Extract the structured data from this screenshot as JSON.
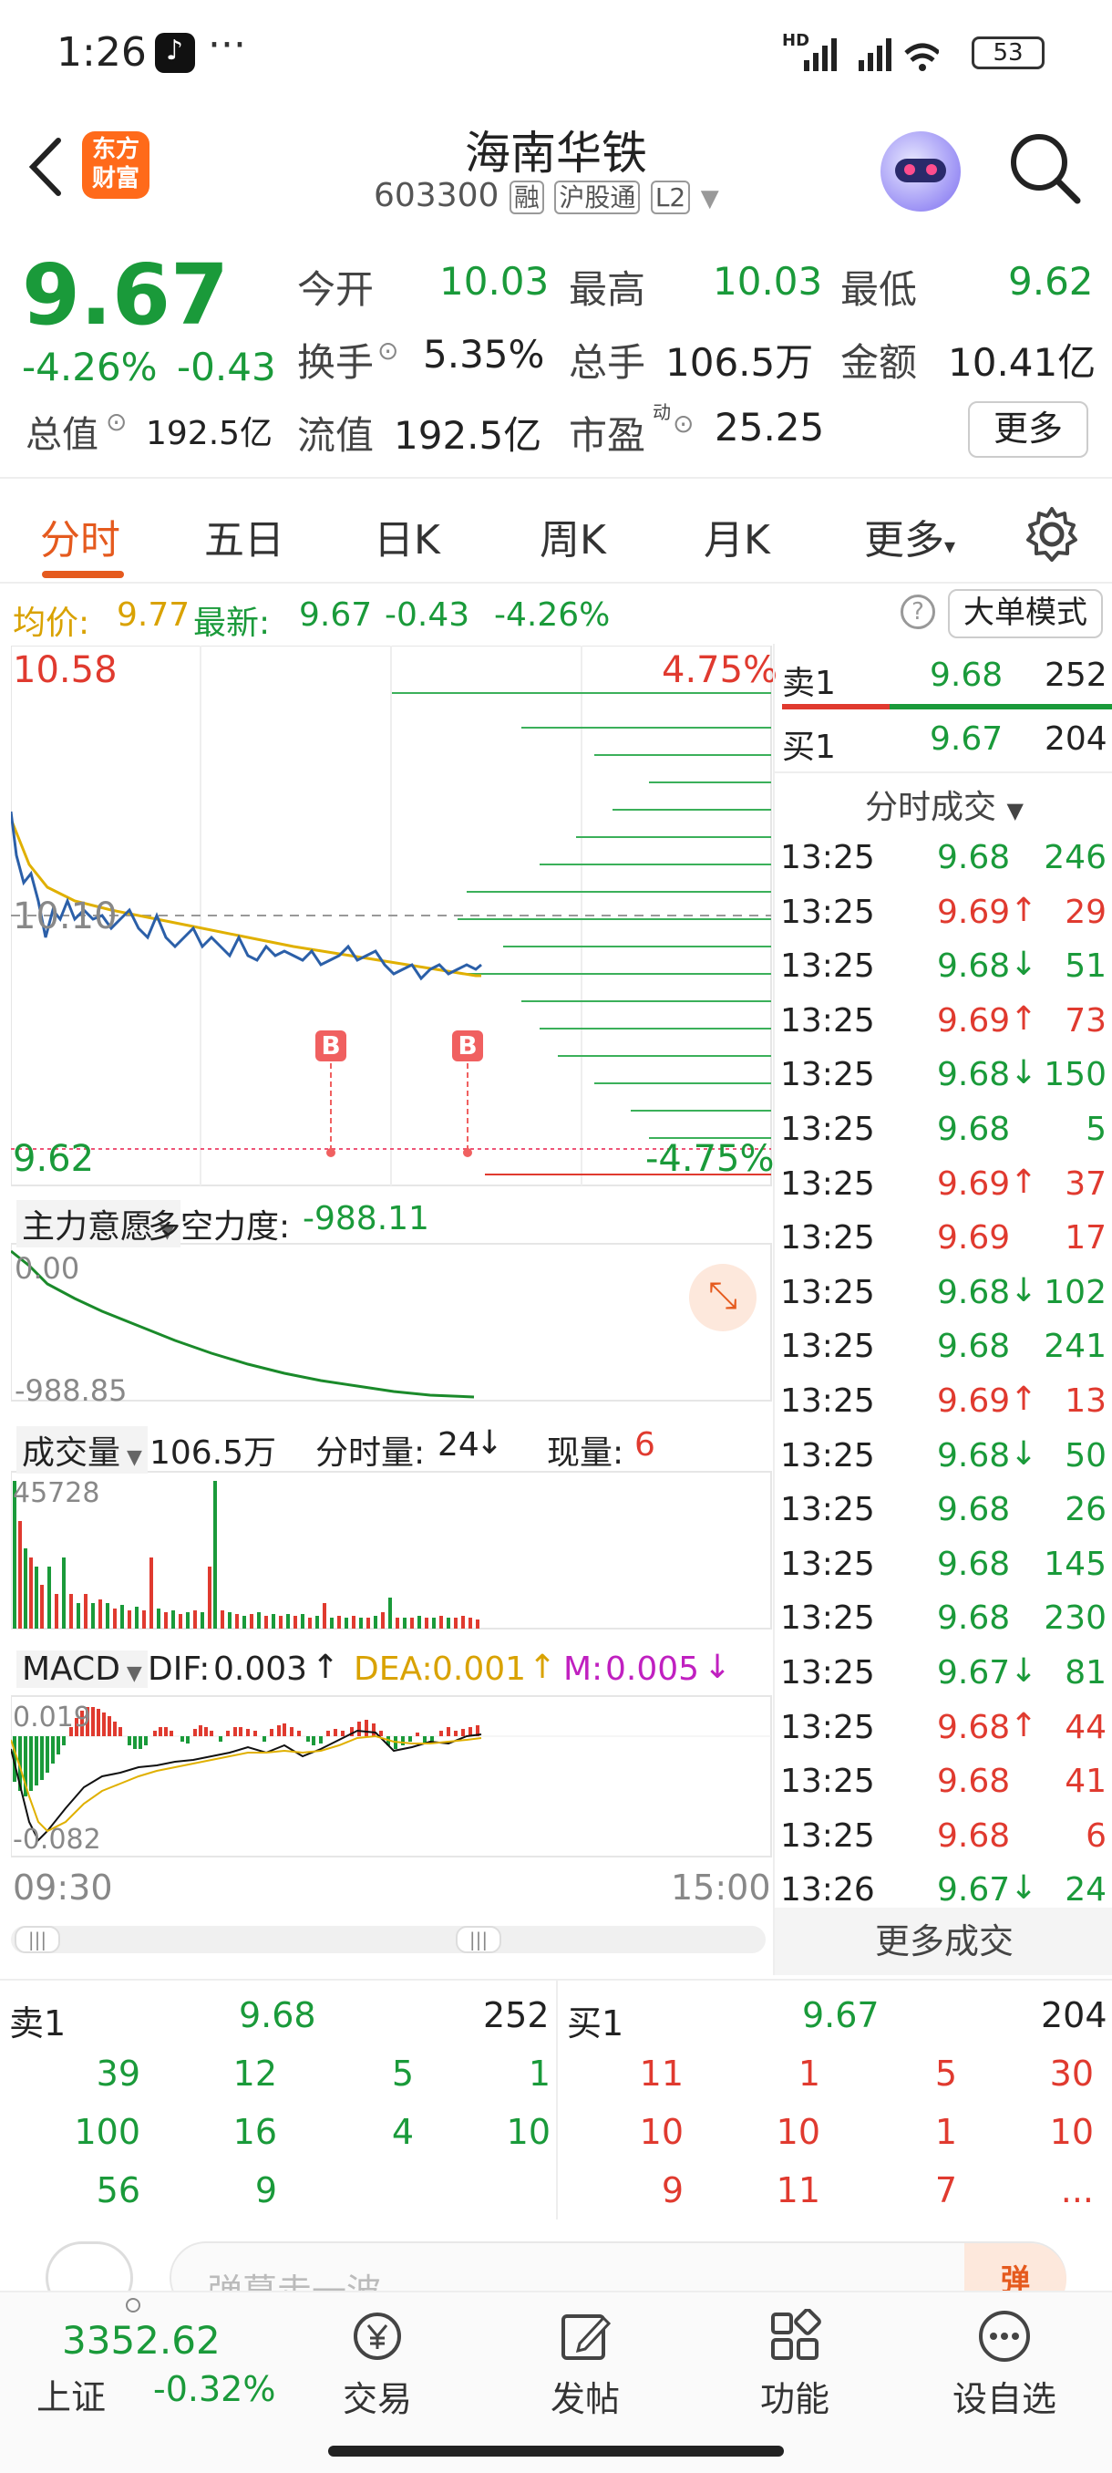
{
  "status_bar": {
    "time": "1:26",
    "battery": "53",
    "signal_label": "HD"
  },
  "header": {
    "logo_line1": "东方",
    "logo_line2": "财富",
    "stock_name": "海南华铁",
    "stock_code": "603300",
    "tag_rong": "融",
    "tag_hgt": "沪股通",
    "tag_level": "L2"
  },
  "quote": {
    "price": "9.67",
    "change_pct": "-4.26%",
    "change": "-0.43",
    "open_label": "今开",
    "open": "10.03",
    "high_label": "最高",
    "high": "10.03",
    "low_label": "最低",
    "low": "9.62",
    "turnover_label": "换手",
    "turnover": "5.35%",
    "volume_label": "总手",
    "volume": "106.5万",
    "amount_label": "金额",
    "amount": "10.41亿",
    "mktcap_label": "总值",
    "mktcap": "192.5亿",
    "float_label": "流值",
    "float": "192.5亿",
    "pe_label": "市盈",
    "pe_sup": "动",
    "pe": "25.25",
    "more_button": "更多"
  },
  "tabs": [
    "分时",
    "五日",
    "日K",
    "周K",
    "月K",
    "更多"
  ],
  "avg_bar": {
    "avg_label": "均价:",
    "avg": "9.77",
    "latest_label": "最新:",
    "latest": "9.67",
    "change": "-0.43",
    "change_pct": "-4.26%",
    "mode_button": "大单模式"
  },
  "main_chart": {
    "ymax": "10.58",
    "ymid": "10.10",
    "ymin": "9.62",
    "pct_top": "4.75%",
    "pct_bottom": "-4.75%",
    "marker": "B"
  },
  "indicator1": {
    "name": "主力意愿",
    "label": "多空力度:",
    "value": "-988.11",
    "top": "0.00",
    "bottom": "-988.85"
  },
  "indicator2": {
    "name": "成交量",
    "total": "106.5万",
    "tick_label": "分时量:",
    "tick": "24",
    "now_label": "现量:",
    "now": "6",
    "ymax": "45728"
  },
  "indicator3": {
    "name": "MACD",
    "dif_label": "DIF:",
    "dif": "0.003",
    "dea_label": "DEA:",
    "dea": "0.001",
    "m_label": "M:",
    "m": "0.005",
    "top": "0.019",
    "bottom": "-0.082"
  },
  "time_axis": {
    "start": "09:30",
    "end": "15:00"
  },
  "order_book_top": {
    "sell_label": "卖1",
    "sell_price": "9.68",
    "sell_vol": "252",
    "buy_label": "买1",
    "buy_price": "9.67",
    "buy_vol": "204"
  },
  "trades_title": "分时成交",
  "trades": [
    {
      "time": "13:25",
      "price": "9.68",
      "arrow": "",
      "vol": "246",
      "color": "green"
    },
    {
      "time": "13:25",
      "price": "9.69",
      "arrow": "↑",
      "vol": "29",
      "color": "red"
    },
    {
      "time": "13:25",
      "price": "9.68",
      "arrow": "↓",
      "vol": "51",
      "color": "green"
    },
    {
      "time": "13:25",
      "price": "9.69",
      "arrow": "↑",
      "vol": "73",
      "color": "red"
    },
    {
      "time": "13:25",
      "price": "9.68",
      "arrow": "↓",
      "vol": "150",
      "color": "green"
    },
    {
      "time": "13:25",
      "price": "9.68",
      "arrow": "",
      "vol": "5",
      "color": "green"
    },
    {
      "time": "13:25",
      "price": "9.69",
      "arrow": "↑",
      "vol": "37",
      "color": "red"
    },
    {
      "time": "13:25",
      "price": "9.69",
      "arrow": "",
      "vol": "17",
      "color": "red"
    },
    {
      "time": "13:25",
      "price": "9.68",
      "arrow": "↓",
      "vol": "102",
      "color": "green"
    },
    {
      "time": "13:25",
      "price": "9.68",
      "arrow": "",
      "vol": "241",
      "color": "green"
    },
    {
      "time": "13:25",
      "price": "9.69",
      "arrow": "↑",
      "vol": "13",
      "color": "red"
    },
    {
      "time": "13:25",
      "price": "9.68",
      "arrow": "↓",
      "vol": "50",
      "color": "green"
    },
    {
      "time": "13:25",
      "price": "9.68",
      "arrow": "",
      "vol": "26",
      "color": "green"
    },
    {
      "time": "13:25",
      "price": "9.68",
      "arrow": "",
      "vol": "145",
      "color": "green"
    },
    {
      "time": "13:25",
      "price": "9.68",
      "arrow": "",
      "vol": "230",
      "color": "green"
    },
    {
      "time": "13:25",
      "price": "9.67",
      "arrow": "↓",
      "vol": "81",
      "color": "green"
    },
    {
      "time": "13:25",
      "price": "9.68",
      "arrow": "↑",
      "vol": "44",
      "color": "red"
    },
    {
      "time": "13:25",
      "price": "9.68",
      "arrow": "",
      "vol": "41",
      "color": "red"
    },
    {
      "time": "13:25",
      "price": "9.68",
      "arrow": "",
      "vol": "6",
      "color": "red"
    },
    {
      "time": "13:26",
      "price": "9.67",
      "arrow": "↓",
      "vol": "24",
      "color": "green"
    }
  ],
  "more_trades": "更多成交",
  "book": {
    "sell_label": "卖1",
    "sell_price": "9.68",
    "sell_vol": "252",
    "buy_label": "买1",
    "buy_price": "9.67",
    "buy_vol": "204",
    "sell_queue": [
      [
        "39",
        "12",
        "5",
        "1"
      ],
      [
        "100",
        "16",
        "4",
        "10"
      ],
      [
        "56",
        "9",
        "",
        ""
      ]
    ],
    "buy_queue": [
      [
        "11",
        "1",
        "5",
        "30"
      ],
      [
        "10",
        "10",
        "1",
        "10"
      ],
      [
        "9",
        "11",
        "7",
        "..."
      ]
    ]
  },
  "comment": {
    "placeholder": "弹幕走一波"
  },
  "bottom_nav": {
    "index_value": "3352.62",
    "index_name": "上证",
    "index_change": "-0.32%",
    "items": [
      "交易",
      "发帖",
      "功能",
      "设自选"
    ]
  },
  "colors": {
    "red": "#e03a2f",
    "green": "#1a9a3a",
    "accent": "#e55a1e",
    "avg_line": "#e0b000",
    "price_line": "#2b5fa8"
  }
}
